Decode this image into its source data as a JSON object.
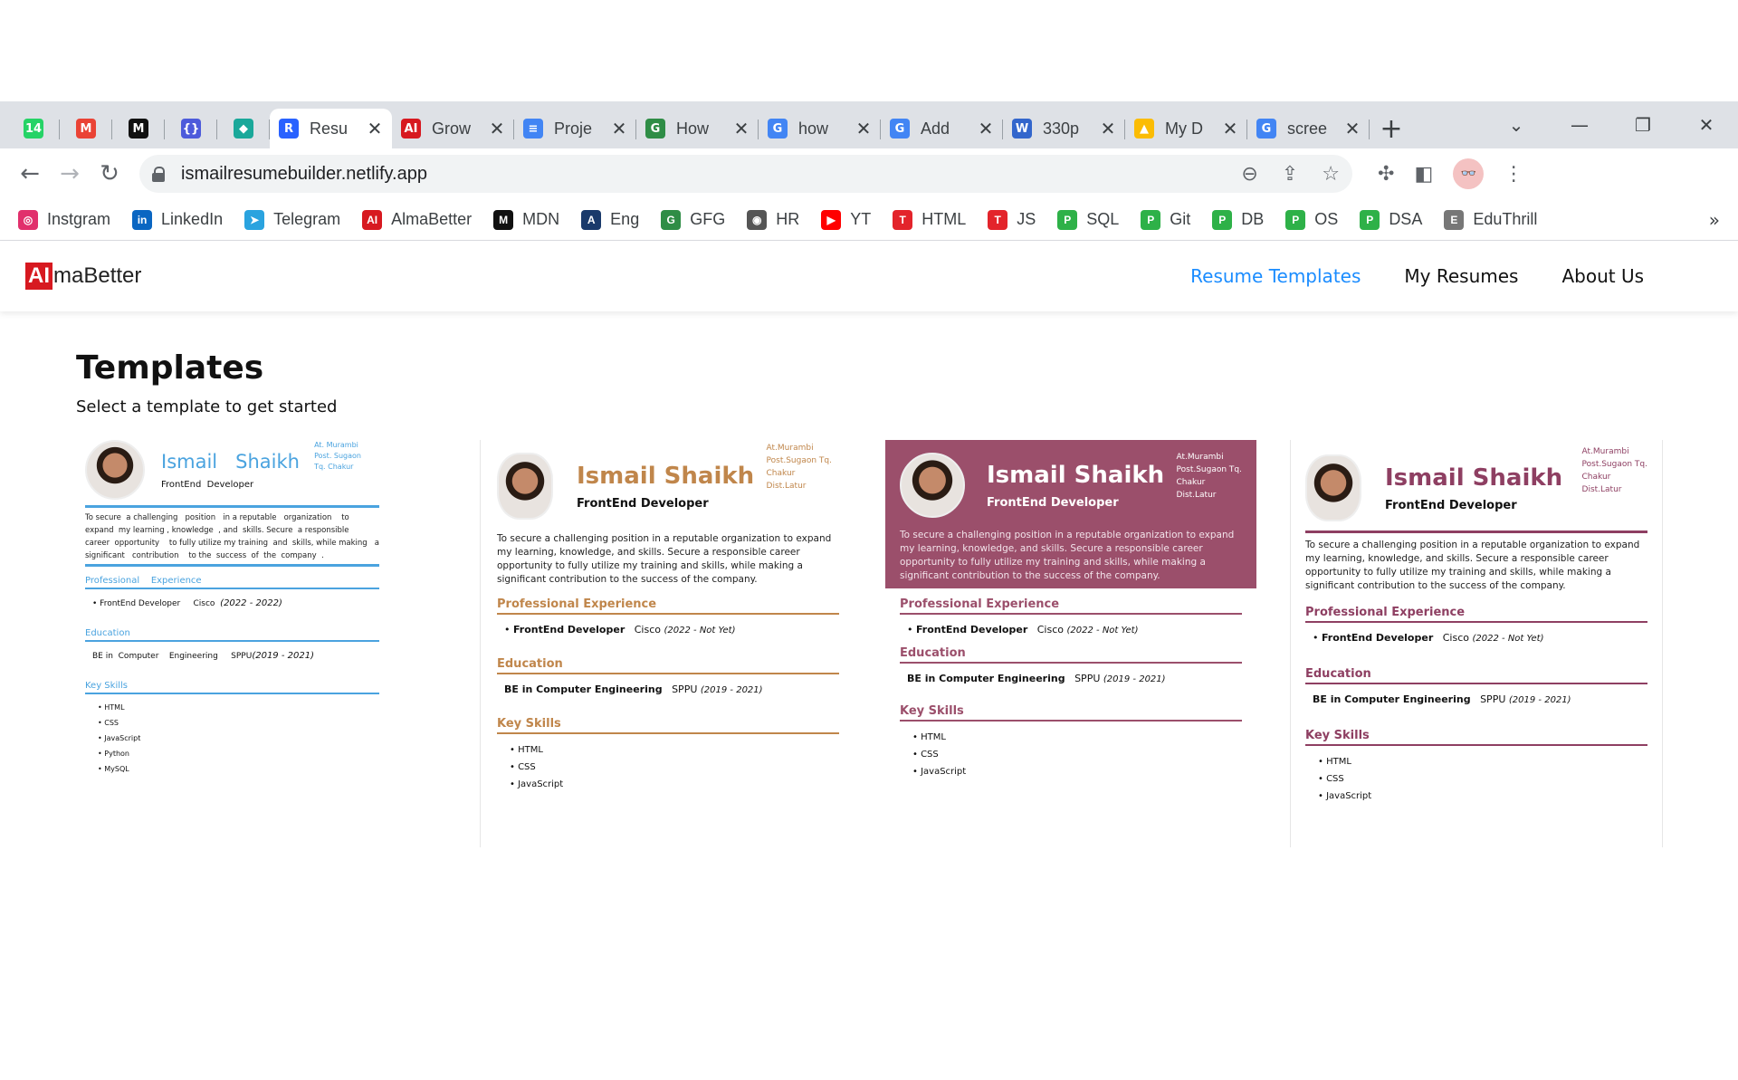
{
  "browser": {
    "tabs": [
      {
        "label": "",
        "icon": "whatsapp-icon",
        "color": "#25d366",
        "badge": "14",
        "pinned": true
      },
      {
        "label": "",
        "icon": "gmail-icon",
        "color": "#ea4335",
        "badge": "M",
        "pinned": true
      },
      {
        "label": "",
        "icon": "medium-icon",
        "color": "#111111",
        "badge": "M",
        "pinned": true
      },
      {
        "label": "",
        "icon": "react-icon",
        "color": "#4d5bdb",
        "badge": "{}",
        "pinned": true
      },
      {
        "label": "",
        "icon": "diamond-icon",
        "color": "#1aa89a",
        "badge": "◆",
        "pinned": true
      },
      {
        "label": "Resu",
        "icon": "resume-icon",
        "color": "#2962ff",
        "badge": "R",
        "active": true
      },
      {
        "label": "Grow",
        "icon": "almabetter-icon",
        "color": "#d71920",
        "badge": "AI"
      },
      {
        "label": "Proje",
        "icon": "docs-icon",
        "color": "#4285f4",
        "badge": "≡"
      },
      {
        "label": "How",
        "icon": "gfg-icon",
        "color": "#2f8d46",
        "badge": "G"
      },
      {
        "label": "how",
        "icon": "google-icon",
        "color": "#4285f4",
        "badge": "G"
      },
      {
        "label": "Add",
        "icon": "google-icon",
        "color": "#4285f4",
        "badge": "G"
      },
      {
        "label": "330p",
        "icon": "wiki-icon",
        "color": "#3366cc",
        "badge": "W"
      },
      {
        "label": "My D",
        "icon": "drive-icon",
        "color": "#fbbc04",
        "badge": "▲"
      },
      {
        "label": "scree",
        "icon": "google-icon",
        "color": "#4285f4",
        "badge": "G"
      }
    ],
    "new_tab_label": "+",
    "url": "ismailresumebuilder.netlify.app",
    "bookmarks": [
      {
        "label": "Instgram",
        "icon": "instagram-icon",
        "color": "#e1306c",
        "badge": "◎"
      },
      {
        "label": "LinkedIn",
        "icon": "linkedin-icon",
        "color": "#0a66c2",
        "badge": "in"
      },
      {
        "label": "Telegram",
        "icon": "telegram-icon",
        "color": "#2aa3df",
        "badge": "➤"
      },
      {
        "label": "AlmaBetter",
        "icon": "almabetter-icon",
        "color": "#d71920",
        "badge": "AI"
      },
      {
        "label": "MDN",
        "icon": "mdn-icon",
        "color": "#111111",
        "badge": "M"
      },
      {
        "label": "Eng",
        "icon": "translate-icon",
        "color": "#1a3a6b",
        "badge": "A"
      },
      {
        "label": "GFG",
        "icon": "gfg-icon",
        "color": "#2f8d46",
        "badge": "G"
      },
      {
        "label": "HR",
        "icon": "globe-icon",
        "color": "#555555",
        "badge": "◉"
      },
      {
        "label": "YT",
        "icon": "youtube-icon",
        "color": "#ff0000",
        "badge": "▶"
      },
      {
        "label": "HTML",
        "icon": "t-icon",
        "color": "#e3242b",
        "badge": "T"
      },
      {
        "label": "JS",
        "icon": "t-icon",
        "color": "#e3242b",
        "badge": "T"
      },
      {
        "label": "SQL",
        "icon": "p-icon",
        "color": "#2eb148",
        "badge": "P"
      },
      {
        "label": "Git",
        "icon": "p-icon",
        "color": "#2eb148",
        "badge": "P"
      },
      {
        "label": "DB",
        "icon": "p-icon",
        "color": "#2eb148",
        "badge": "P"
      },
      {
        "label": "OS",
        "icon": "p-icon",
        "color": "#2eb148",
        "badge": "P"
      },
      {
        "label": "DSA",
        "icon": "p-icon",
        "color": "#2eb148",
        "badge": "P"
      },
      {
        "label": "EduThrill",
        "icon": "eduthrill-icon",
        "color": "#777777",
        "badge": "E"
      }
    ],
    "bookmarks_more": "»"
  },
  "site": {
    "logo_box": "AI",
    "logo_text": "maBetter",
    "nav": [
      "Resume Templates",
      "My Resumes",
      "About Us"
    ],
    "active_color": "#1a8cff"
  },
  "page": {
    "title": "Templates",
    "subtitle": "Select a template to get started"
  },
  "resume": {
    "name": "Ismail Shaikh",
    "name_spaced": "Ismail   Shaikh",
    "role": "FrontEnd Developer",
    "role_spaced": "FrontEnd  Developer",
    "address": [
      "At.Murambi",
      "Post.Sugaon Tq.",
      "Chakur",
      "Dist.Latur"
    ],
    "address_t1": [
      "At. Murambi",
      "Post. Sugaon",
      "Tq. Chakur"
    ],
    "objective": "To secure a challenging position in a reputable organization to expand my learning, knowledge, and skills. Secure a responsible career opportunity to fully utilize my training and skills, while making a significant contribution to the success of the company.",
    "objective_t1": "To secure  a challenging   position   in a reputable   organization    to expand  my learning , knowledge  , and  skills. Secure  a responsible   career  opportunity    to fully utilize my training  and  skills, while making   a significant   contribution    to the  success  of  the  company  .",
    "sections": {
      "experience": "Professional Experience",
      "experience_spaced": "Professional    Experience",
      "education": "Education",
      "skills": "Key Skills"
    },
    "exp_title": "FrontEnd Developer",
    "exp_company": "Cisco",
    "exp_dates": "(2022 - Not Yet)",
    "exp_dates_t1": "(2022 - 2022)",
    "edu_degree": "BE in Computer Engineering",
    "edu_degree_t1": "BE in  Computer    Engineering",
    "edu_univ": "SPPU",
    "edu_dates": "(2019 - 2021)",
    "edu_dates_t1": "(2019 - 2021)",
    "skills_full": [
      "HTML",
      "CSS",
      "JavaScript",
      "Python",
      "MySQL"
    ],
    "skills_short": [
      "HTML",
      "CSS",
      "JavaScript"
    ]
  },
  "template_colors": {
    "t1": "#4aa3df",
    "t2": "#c0864b",
    "t3_bg": "#9b4f6b",
    "t3": "#9b4f6b",
    "t4": "#8e3f62"
  }
}
